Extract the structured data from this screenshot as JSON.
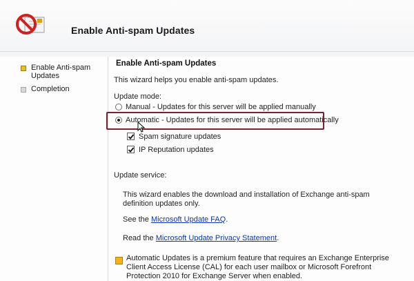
{
  "header": {
    "title": "Enable Anti-spam Updates",
    "icon": "no-spam-envelope-icon"
  },
  "nav": {
    "items": [
      {
        "label": "Enable Anti-spam Updates",
        "state": "active"
      },
      {
        "label": "Completion",
        "state": "inactive"
      }
    ]
  },
  "main": {
    "title": "Enable Anti-spam Updates",
    "intro": "This wizard helps you enable anti-spam updates.",
    "update_mode_label": "Update mode:",
    "options": {
      "manual": "Manual - Updates for this server will be applied manually",
      "automatic": "Automatic - Updates for this server will be applied automatically",
      "selected": "automatic"
    },
    "checkboxes": {
      "spam_signature": {
        "label": "Spam signature updates",
        "checked": true
      },
      "ip_reputation": {
        "label": "IP Reputation updates",
        "checked": true
      }
    },
    "update_service_label": "Update service:",
    "service_text": "This wizard enables the download and installation of Exchange anti-spam definition updates only.",
    "faq": {
      "prefix": "See the",
      "link": "Microsoft Update FAQ",
      "suffix": "."
    },
    "privacy": {
      "prefix": "Read the",
      "link": "Microsoft Update Privacy Statement",
      "suffix": "."
    },
    "notice": "Automatic Updates is a premium feature that requires an Exchange Enterprise Client Access License (CAL) for each user mailbox or Microsoft Forefront Protection 2010 for Exchange Server when enabled."
  },
  "colors": {
    "highlight_border": "#7a1f2b",
    "link": "#0b35b8",
    "active_bullet": "#e8c21c",
    "info_icon": "#f2b416"
  }
}
